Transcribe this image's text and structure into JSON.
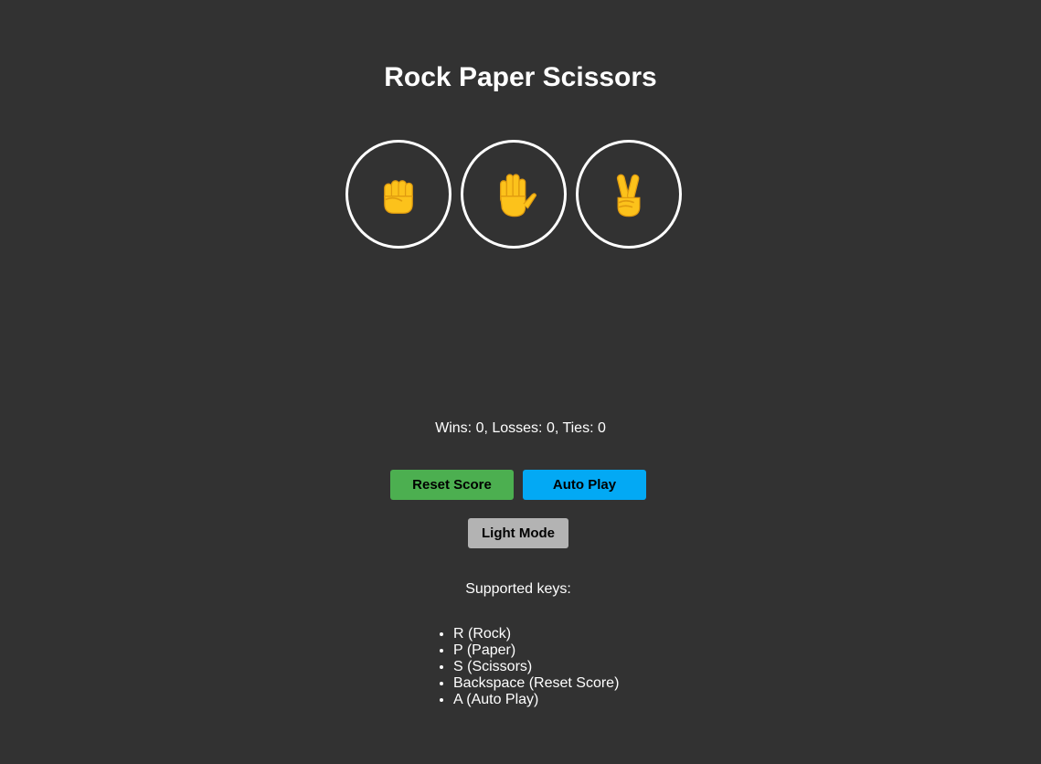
{
  "title": "Rock Paper Scissors",
  "moves": [
    {
      "name": "rock",
      "icon": "raised-fist-icon"
    },
    {
      "name": "paper",
      "icon": "raised-hand-icon"
    },
    {
      "name": "scissors",
      "icon": "victory-hand-icon"
    }
  ],
  "score": {
    "text": "Wins: 0, Losses: 0, Ties: 0",
    "wins": 0,
    "losses": 0,
    "ties": 0
  },
  "buttons": {
    "reset_label": "Reset Score",
    "auto_play_label": "Auto Play",
    "mode_label": "Light Mode"
  },
  "keys": {
    "title": "Supported keys:",
    "items": [
      "R (Rock)",
      "P (Paper)",
      "S (Scissors)",
      "Backspace (Reset Score)",
      "A (Auto Play)"
    ]
  },
  "colors": {
    "background": "#323232",
    "reset_button": "#4caf50",
    "auto_play_button": "#03a9f4",
    "mode_button": "#b3b3b3",
    "emoji_yellow": "#fcc21b"
  }
}
